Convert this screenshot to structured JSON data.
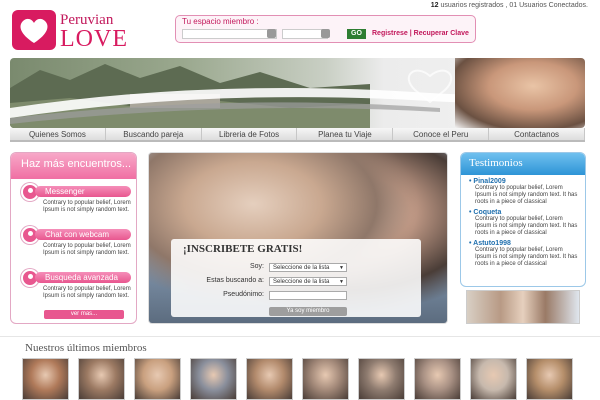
{
  "logo": {
    "line1": "Peruvian",
    "line2": "LOVE"
  },
  "stats": {
    "count": "12",
    "text": " usuarios registrados , 01 Usuarios Conectados."
  },
  "login": {
    "title": "Tu espacio miembro :",
    "go_label": "GO",
    "links": "Registrese | Recuperar Clave"
  },
  "nav": [
    "Quienes Somos",
    "Buscando pareja",
    "Libreria de Fotos",
    "Planea tu Viaje",
    "Conoce el Peru",
    "Contactanos"
  ],
  "left": {
    "heading": "Haz más encuentros...",
    "features": [
      {
        "title": "Messenger",
        "text": "Contrary to popular belief, Lorem Ipsum is not simply random text."
      },
      {
        "title": "Chat con webcam",
        "text": "Contrary to popular belief, Lorem Ipsum is not simply random text."
      },
      {
        "title": "Busqueda avanzada",
        "text": "Contrary to popular belief, Lorem Ipsum is not simply random text."
      }
    ],
    "more": "ver mas..."
  },
  "register": {
    "title": "¡INSCRIBETE GRATIS!",
    "soy_label": "Soy:",
    "soy_value": "Seleccione de la lista",
    "buscando_label": "Estas buscando a:",
    "buscando_value": "Seleccione de la lista",
    "pseudo_label": "Pseudónimo:",
    "button": "Ya soy miembro"
  },
  "testimonials": {
    "heading": "Testimonios",
    "items": [
      {
        "name": "Pinal2009",
        "text": "Contrary to popular belief, Lorem Ipsum is not simply random text. It has roots in a piece of classical"
      },
      {
        "name": "Coqueta",
        "text": "Contrary to popular belief, Lorem Ipsum is not simply random text. It has roots in a piece of classical"
      },
      {
        "name": "Astuto1998",
        "text": "Contrary to popular belief, Lorem Ipsum is not simply random text. It has roots in a piece of classical"
      }
    ]
  },
  "members": {
    "title": "Nuestros últimos miembros",
    "colors": [
      "#b07a5a",
      "#9c7a63",
      "#c9a07f",
      "#8a8f9c",
      "#b28a6c",
      "#a48a7a",
      "#8f7c70",
      "#a99184",
      "#c7b9ad",
      "#b58e6a"
    ]
  },
  "colors": {
    "brand_pink": "#e8578f",
    "brand_blue": "#2d94d6"
  }
}
